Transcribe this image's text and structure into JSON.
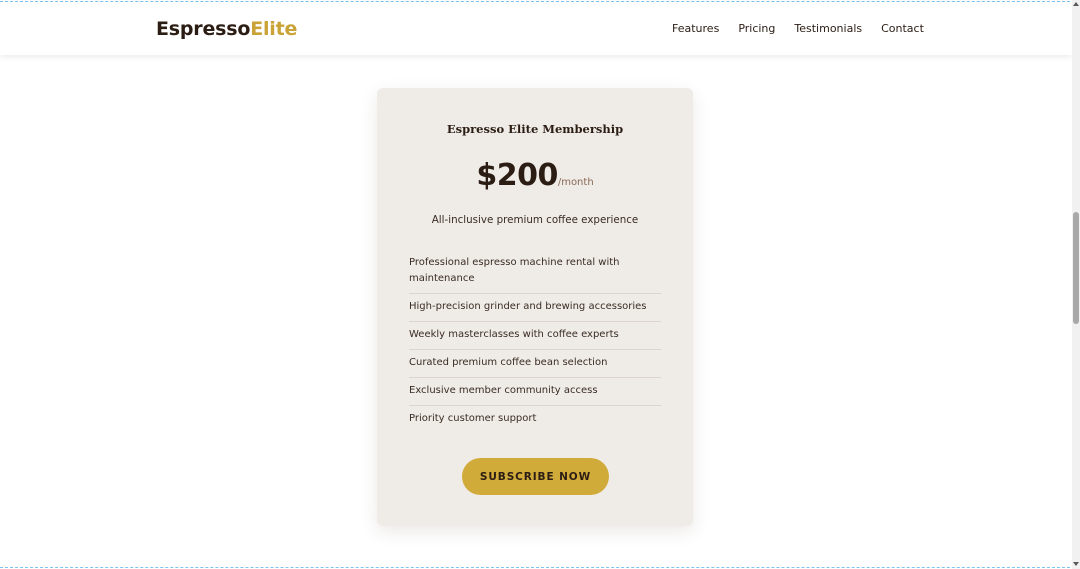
{
  "nav": {
    "logo_part_1": "Espresso",
    "logo_part_2": "Elite",
    "links": [
      "Features",
      "Pricing",
      "Testimonials",
      "Contact"
    ]
  },
  "card": {
    "title": "Espresso Elite Membership",
    "price": "$200",
    "period": "/month",
    "description": "All-inclusive premium coffee experience",
    "features": [
      "Professional espresso machine rental with maintenance",
      "High-precision grinder and brewing accessories",
      "Weekly masterclasses with coffee experts",
      "Curated premium coffee bean selection",
      "Exclusive member community access",
      "Priority customer support"
    ],
    "button_label": "SUBSCRIBE NOW"
  },
  "colors": {
    "brand_dark": "#2b1d14",
    "brand_gold": "#c9a336",
    "button": "#d1ab3a",
    "card_bg": "#efebe7"
  },
  "icons": {
    "scroll_up": "triangle-up-icon",
    "scroll_down": "triangle-down-icon"
  }
}
